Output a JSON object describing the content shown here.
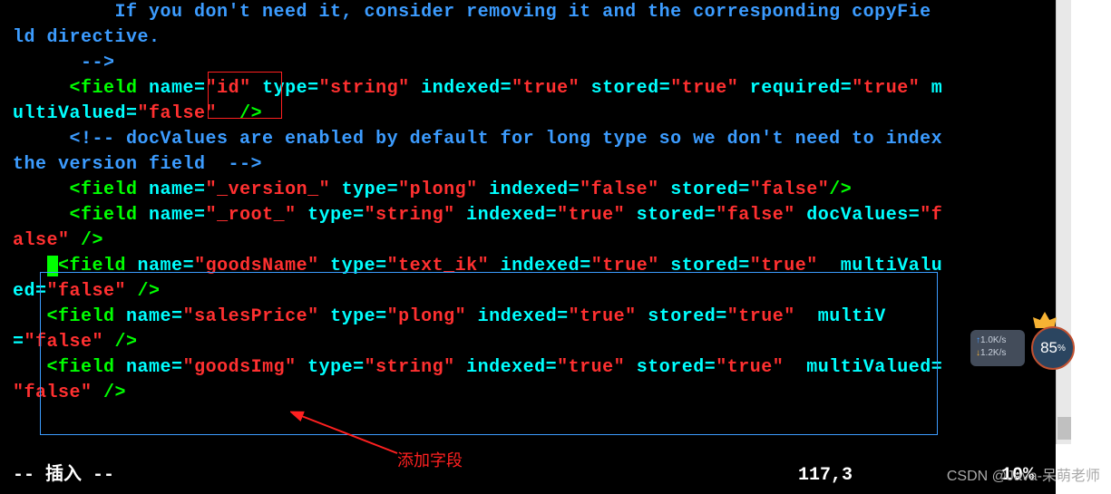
{
  "code": {
    "l1_a": "         If you don't need it, consider removing it and the corresponding copyFie",
    "l1_b": "ld directive.",
    "l2": "      -->",
    "l3_blank": "",
    "f_id": {
      "indent": "     ",
      "open": "<field",
      "name_k": " name",
      "name_v": "\"id\"",
      "type_k": " type",
      "type_v": "\"string\"",
      "idx_k": " indexed",
      "idx_v": "\"true\"",
      "sto_k": " stored",
      "sto_v": "\"true\"",
      "req_k": " required",
      "req_v": "\"true\"",
      "mv_pre": " m",
      "mv_wrap_a": "ultiValued",
      "mv_wrap_v": "\"false\"",
      "close": "  />"
    },
    "cmt2": "     <!-- docValues are enabled by default for long type so we don't need to index ",
    "cmt2b": "the version field  -->",
    "f_ver": {
      "indent": "     ",
      "open": "<field",
      "name_k": " name",
      "name_v": "\"_version_\"",
      "type_k": " type",
      "type_v": "\"plong\"",
      "idx_k": " indexed",
      "idx_v": "\"false\"",
      "sto_k": " stored",
      "sto_v": "\"false\"",
      "close": "/>"
    },
    "f_root": {
      "indent": "     ",
      "open": "<field",
      "name_k": " name",
      "name_v": "\"_root_\"",
      "type_k": " type",
      "type_v": "\"string\"",
      "idx_k": " indexed",
      "idx_v": "\"true\"",
      "sto_k": " stored",
      "sto_v": "\"false\"",
      "dv_k": " docValues",
      "dv_v": "\"f",
      "dv_wrap": "alse\"",
      "close": " />"
    },
    "f_gn": {
      "indent": "   ",
      "cursor": " ",
      "open": "<field",
      "name_k": " name",
      "name_v": "\"goodsName\"",
      "type_k": " type",
      "type_v": "\"text_ik\"",
      "idx_k": " indexed",
      "idx_v": "\"true\"",
      "sto_k": " stored",
      "sto_v": "\"true\"",
      "mv_k": "  multiValu",
      "mv_wrap_a": "ed",
      "mv_wrap_v": "\"false\"",
      "close": " />"
    },
    "f_sp": {
      "indent": "   ",
      "open": "<field",
      "name_k": " name",
      "name_v": "\"salesPrice\"",
      "type_k": " type",
      "type_v": "\"plong\"",
      "idx_k": " indexed",
      "idx_v": "\"true\"",
      "sto_k": " stored",
      "sto_v": "\"true\"",
      "mv_k": "  multiV",
      "mv_wrap_a": "",
      "mv_wrap_v": "\"false\"",
      "close": " />"
    },
    "f_gi": {
      "indent": "   ",
      "open": "<field",
      "name_k": " name",
      "name_v": "\"goodsImg\"",
      "type_k": " type",
      "type_v": "\"string\"",
      "idx_k": " indexed",
      "idx_v": "\"true\"",
      "sto_k": " stored",
      "sto_v": "\"true\"",
      "mv_k": "  multiValued",
      "mv_wrap_v": "\"false\"",
      "close": " />"
    }
  },
  "annotation": {
    "label": "添加字段"
  },
  "status": {
    "mode": "-- 插入 --",
    "position": "117,3",
    "percent": "10%"
  },
  "watermark": "CSDN @Java-呆萌老师",
  "net": {
    "up": "1.0K/s",
    "down": "1.2K/s"
  },
  "badge": {
    "value": "85",
    "unit": "%"
  }
}
